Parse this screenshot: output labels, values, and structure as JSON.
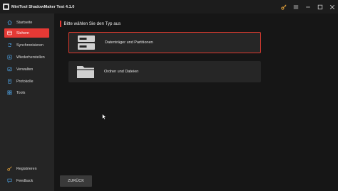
{
  "window": {
    "title": "MiniTool ShadowMaker Test 4.1.0"
  },
  "sidebar": {
    "items": [
      {
        "label": "Startseite",
        "icon": "home-icon"
      },
      {
        "label": "Sichern",
        "icon": "backup-icon",
        "active": true
      },
      {
        "label": "Synchronisieren",
        "icon": "sync-icon"
      },
      {
        "label": "Wiederherstellen",
        "icon": "restore-icon"
      },
      {
        "label": "Verwalten",
        "icon": "manage-icon"
      },
      {
        "label": "Protokolle",
        "icon": "log-icon"
      },
      {
        "label": "Tools",
        "icon": "tools-icon"
      }
    ],
    "bottom_items": [
      {
        "label": "Registrieren",
        "icon": "key-icon"
      },
      {
        "label": "Feedback",
        "icon": "feedback-icon"
      }
    ]
  },
  "main": {
    "heading": "Bitte wählen Sie den Typ aus",
    "options": [
      {
        "label": "Datenträger und Partitionen",
        "icon": "disk-icon",
        "selected": true
      },
      {
        "label": "Ordner und Dateien",
        "icon": "folder-icon",
        "selected": false
      }
    ],
    "back_label": "ZURÜCK"
  },
  "colors": {
    "accent": "#e53935",
    "sidebar_bg": "#252525",
    "main_bg": "#161616",
    "card_bg": "#262626"
  }
}
